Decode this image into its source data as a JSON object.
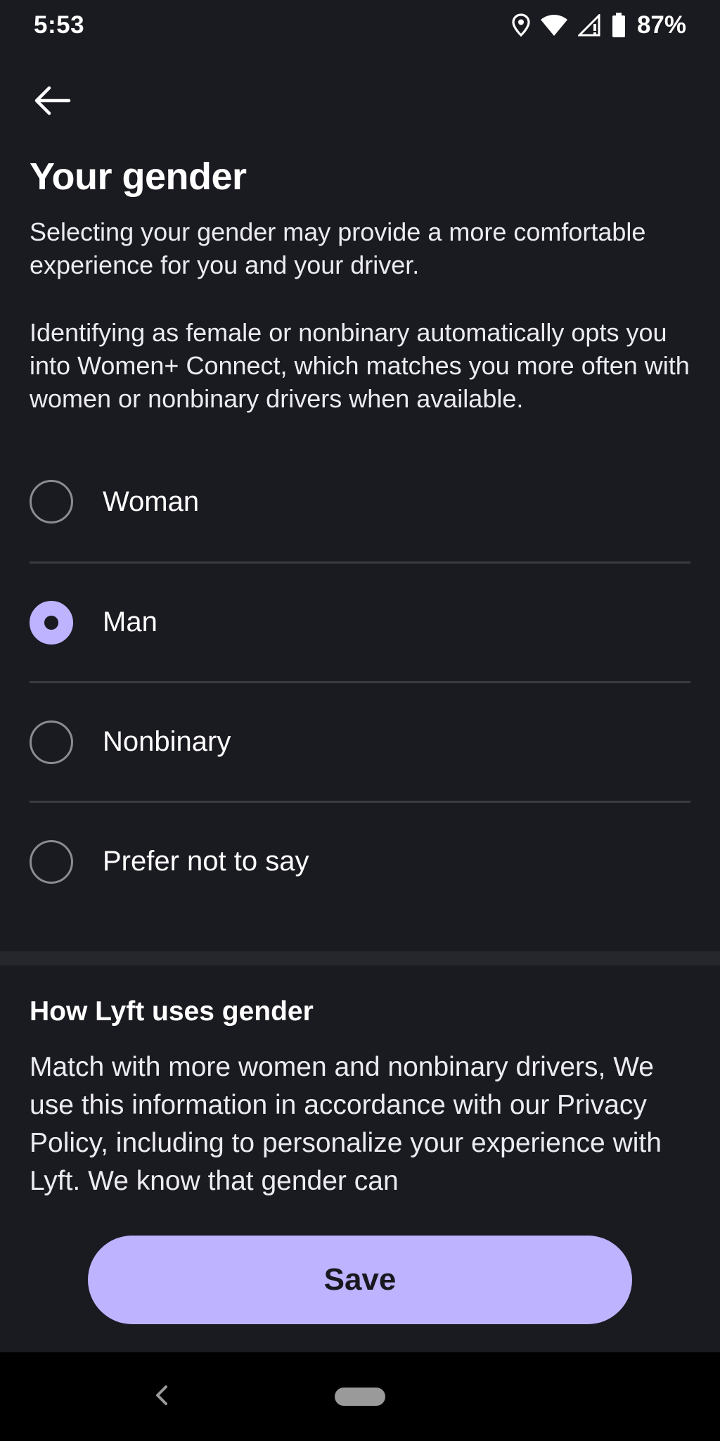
{
  "status_bar": {
    "time": "5:53",
    "battery": "87%",
    "icons": [
      "location-icon",
      "wifi-icon",
      "signal-icon",
      "battery-icon"
    ]
  },
  "header": {
    "back_icon": "arrow-left-icon",
    "title": "Your gender"
  },
  "description": {
    "paragraph1": "Selecting your gender may provide a more comfortable experience for you and your driver.",
    "paragraph2": "Identifying as female or nonbinary automatically opts you into Women+ Connect, which matches you more often with women or nonbinary drivers when available."
  },
  "options": [
    {
      "label": "Woman",
      "selected": false
    },
    {
      "label": "Man",
      "selected": true
    },
    {
      "label": "Nonbinary",
      "selected": false
    },
    {
      "label": "Prefer not to say",
      "selected": false
    }
  ],
  "info": {
    "title": "How Lyft uses gender",
    "body": "Match with more women and nonbinary drivers, We use this information in accordance with our Privacy Policy, including to personalize your experience with Lyft. We know that gender can"
  },
  "save_button": {
    "label": "Save"
  },
  "nav_bar": {
    "back_icon": "chevron-left-icon",
    "home_icon": "home-pill-icon"
  },
  "colors": {
    "background": "#1a1a21",
    "accent": "#bdb3ff",
    "divider": "#3a3a42",
    "text": "#ffffff"
  }
}
